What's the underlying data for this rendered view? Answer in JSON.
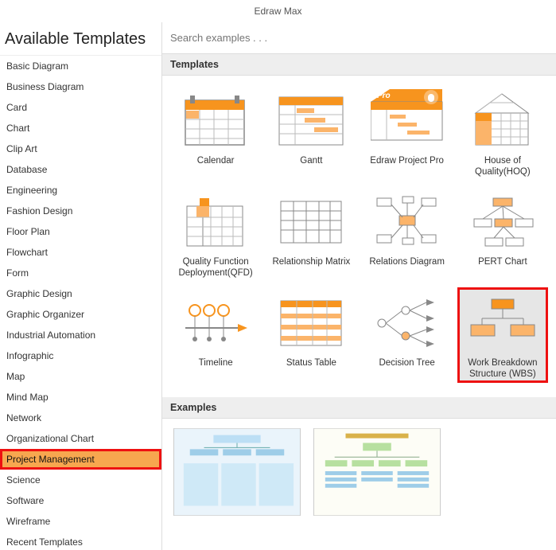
{
  "app": {
    "title": "Edraw Max"
  },
  "sidebar": {
    "header": "Available Templates",
    "items": [
      {
        "label": "Basic Diagram"
      },
      {
        "label": "Business Diagram"
      },
      {
        "label": "Card"
      },
      {
        "label": "Chart"
      },
      {
        "label": "Clip Art"
      },
      {
        "label": "Database"
      },
      {
        "label": "Engineering"
      },
      {
        "label": "Fashion Design"
      },
      {
        "label": "Floor Plan"
      },
      {
        "label": "Flowchart"
      },
      {
        "label": "Form"
      },
      {
        "label": "Graphic Design"
      },
      {
        "label": "Graphic Organizer"
      },
      {
        "label": "Industrial Automation"
      },
      {
        "label": "Infographic"
      },
      {
        "label": "Map"
      },
      {
        "label": "Mind Map"
      },
      {
        "label": "Network"
      },
      {
        "label": "Organizational Chart"
      },
      {
        "label": "Project Management",
        "selected": true,
        "highlighted": true
      },
      {
        "label": "Science"
      },
      {
        "label": "Software"
      },
      {
        "label": "Wireframe"
      },
      {
        "label": "Recent Templates"
      }
    ]
  },
  "search": {
    "placeholder": "Search examples . . ."
  },
  "sections": {
    "templates_header": "Templates",
    "examples_header": "Examples"
  },
  "templates": [
    {
      "label": "Calendar",
      "icon": "calendar"
    },
    {
      "label": "Gantt",
      "icon": "gantt"
    },
    {
      "label": "Edraw Project Pro",
      "icon": "project-pro",
      "badge": "Pro"
    },
    {
      "label": "House of Quality(HOQ)",
      "icon": "hoq"
    },
    {
      "label": "Quality Function Deployment(QFD)",
      "icon": "qfd"
    },
    {
      "label": "Relationship Matrix",
      "icon": "matrix"
    },
    {
      "label": "Relations Diagram",
      "icon": "relations"
    },
    {
      "label": "PERT Chart",
      "icon": "pert"
    },
    {
      "label": "Timeline",
      "icon": "timeline"
    },
    {
      "label": "Status Table",
      "icon": "status-table"
    },
    {
      "label": "Decision Tree",
      "icon": "decision-tree"
    },
    {
      "label": "Work Breakdown Structure (WBS)",
      "icon": "wbs",
      "highlighted": true
    }
  ],
  "examples": [
    {
      "name": "example-1"
    },
    {
      "name": "example-2"
    }
  ],
  "colors": {
    "accent": "#f7941e",
    "accent_light": "#fbb46a"
  }
}
